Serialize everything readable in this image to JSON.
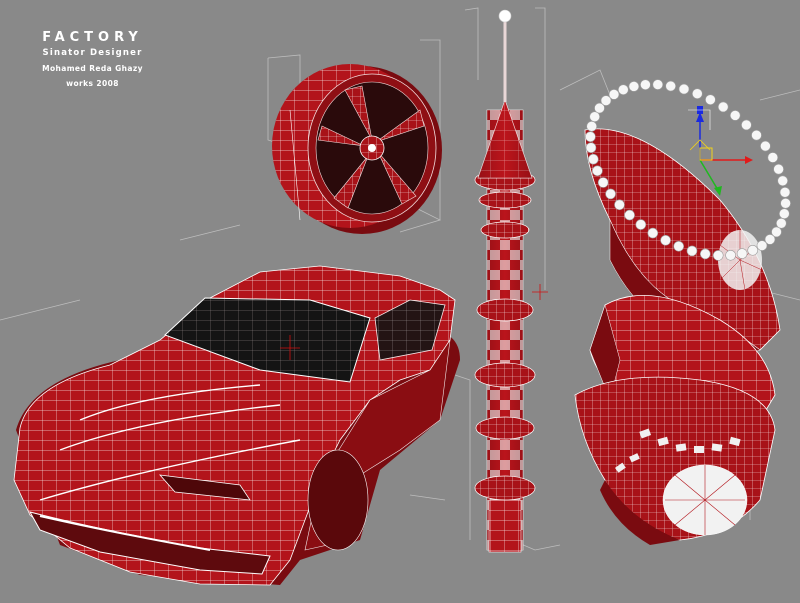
{
  "credits": {
    "title": "FACTORY",
    "subtitle": "Sinator Designer",
    "author": "Mohamed Reda Ghazy",
    "year_line": "works 2008"
  },
  "objects": [
    {
      "name": "car-model-icon"
    },
    {
      "name": "wheel-rim-icon"
    },
    {
      "name": "minaret-tower-icon"
    },
    {
      "name": "abstract-sculpture-icon"
    },
    {
      "name": "bead-spline-icon"
    },
    {
      "name": "transform-gizmo-icon"
    }
  ],
  "colors": {
    "viewport_bg": "#898989",
    "mesh_red": "#b3141b",
    "mesh_dark": "#6e0a0e",
    "wire": "#ffffff",
    "gizmo_x": "#e21a1a",
    "gizmo_y": "#1fb81f",
    "gizmo_z": "#1a2ae0"
  }
}
